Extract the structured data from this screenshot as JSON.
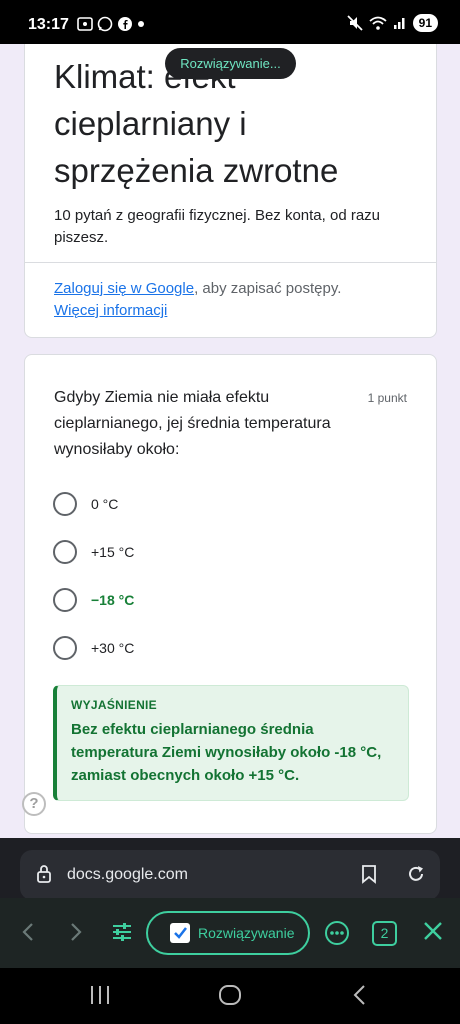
{
  "status": {
    "time": "13:17",
    "battery": "91"
  },
  "toast": {
    "label": "Rozwiązywanie..."
  },
  "form": {
    "title": "Klimat: efekt cieplarniany i sprzężenia zwrotne",
    "description": "10 pytań z geografii fizycznej. Bez konta, od razu piszesz.",
    "login_link": "Zaloguj się w Google",
    "login_suffix": ", aby zapisać postępy.",
    "more_info": "Więcej informacji"
  },
  "question": {
    "text": "Gdyby Ziemia nie miała efektu cieplarnianego, jej średnia temperatura wynosiłaby około:",
    "points": "1 punkt",
    "options": [
      {
        "label": "0 °C"
      },
      {
        "label": "+15 °C"
      },
      {
        "label": "−18 °C"
      },
      {
        "label": "+30 °C"
      }
    ],
    "explanation_title": "WYJAŚNIENIE",
    "explanation_text": "Bez efektu cieplarnianego średnia temperatura Ziemi wynosiłaby około -18 °C, zamiast obecnych około +15 °C."
  },
  "help": {
    "label": "?"
  },
  "browser": {
    "url": "docs.google.com"
  },
  "toolbar": {
    "pill_label": "Rozwiązywanie",
    "tab_count": "2"
  },
  "colors": {
    "accent": "#3ecf9f",
    "correct": "#188038",
    "link": "#1a73e8"
  }
}
